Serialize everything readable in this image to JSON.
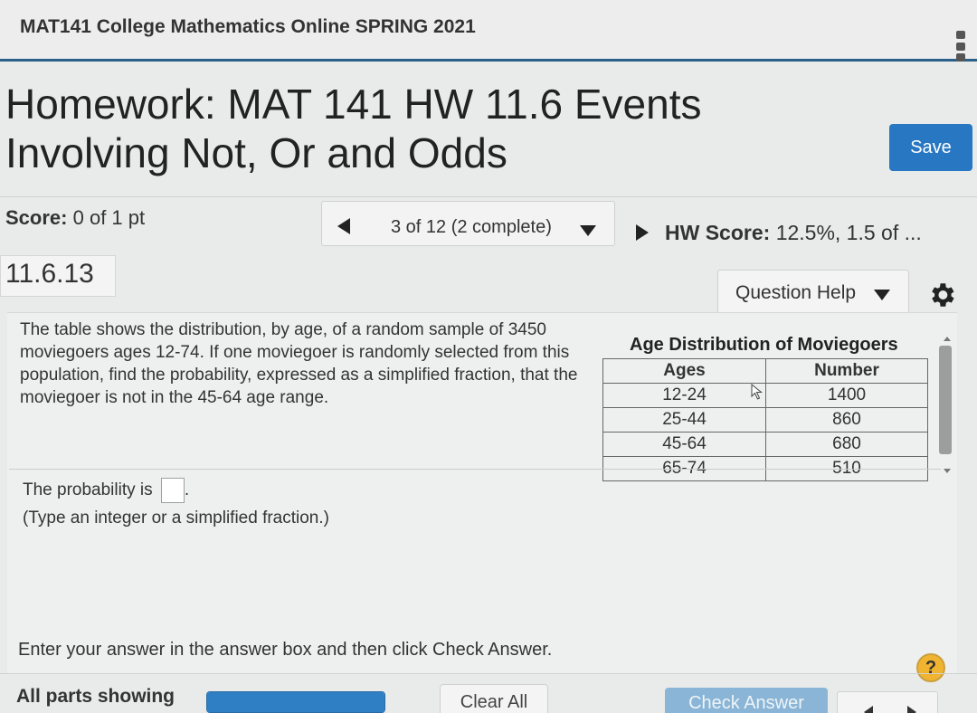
{
  "course": {
    "title": "MAT141 College Mathematics Online SPRING 2021"
  },
  "homework": {
    "title_line1": "Homework: MAT 141 HW 11.6 Events",
    "title_line2": "Involving Not, Or and Odds",
    "save_label": "Save"
  },
  "score": {
    "label": "Score:",
    "value": "0 of 1 pt"
  },
  "navigation": {
    "position_label": "3 of 12 (2 complete)",
    "hw_score_label": "HW Score:",
    "hw_score_value": "12.5%, 1.5 of ..."
  },
  "question": {
    "number": "11.6.13",
    "help_label": "Question Help",
    "text": "The table shows the distribution, by age, of a random sample of 3450 moviegoers ages 12-74. If one moviegoer is randomly selected from this population, find the probability, expressed as a simplified fraction, that the moviegoer is not in the 45-64 age range.",
    "table": {
      "caption": "Age Distribution of Moviegoers",
      "headers": [
        "Ages",
        "Number"
      ],
      "rows": [
        [
          "12-24",
          "1400"
        ],
        [
          "25-44",
          "860"
        ],
        [
          "45-64",
          "680"
        ],
        [
          "65-74",
          "510"
        ]
      ]
    },
    "answer_prompt": "The probability is",
    "answer_value": "",
    "answer_suffix": ".",
    "answer_hint": "(Type an integer or a simplified fraction.)"
  },
  "footer": {
    "instructions": "Enter your answer in the answer box and then click Check Answer.",
    "help_symbol": "?",
    "all_parts_label": "All parts showing",
    "progress_fraction": 1.0,
    "clear_label": "Clear All",
    "check_label": "Check Answer"
  },
  "colors": {
    "accent": "#2877c2",
    "header_rule": "#2a5f8a",
    "help_badge": "#f0b430",
    "check_disabled": "#8ab5d6"
  }
}
